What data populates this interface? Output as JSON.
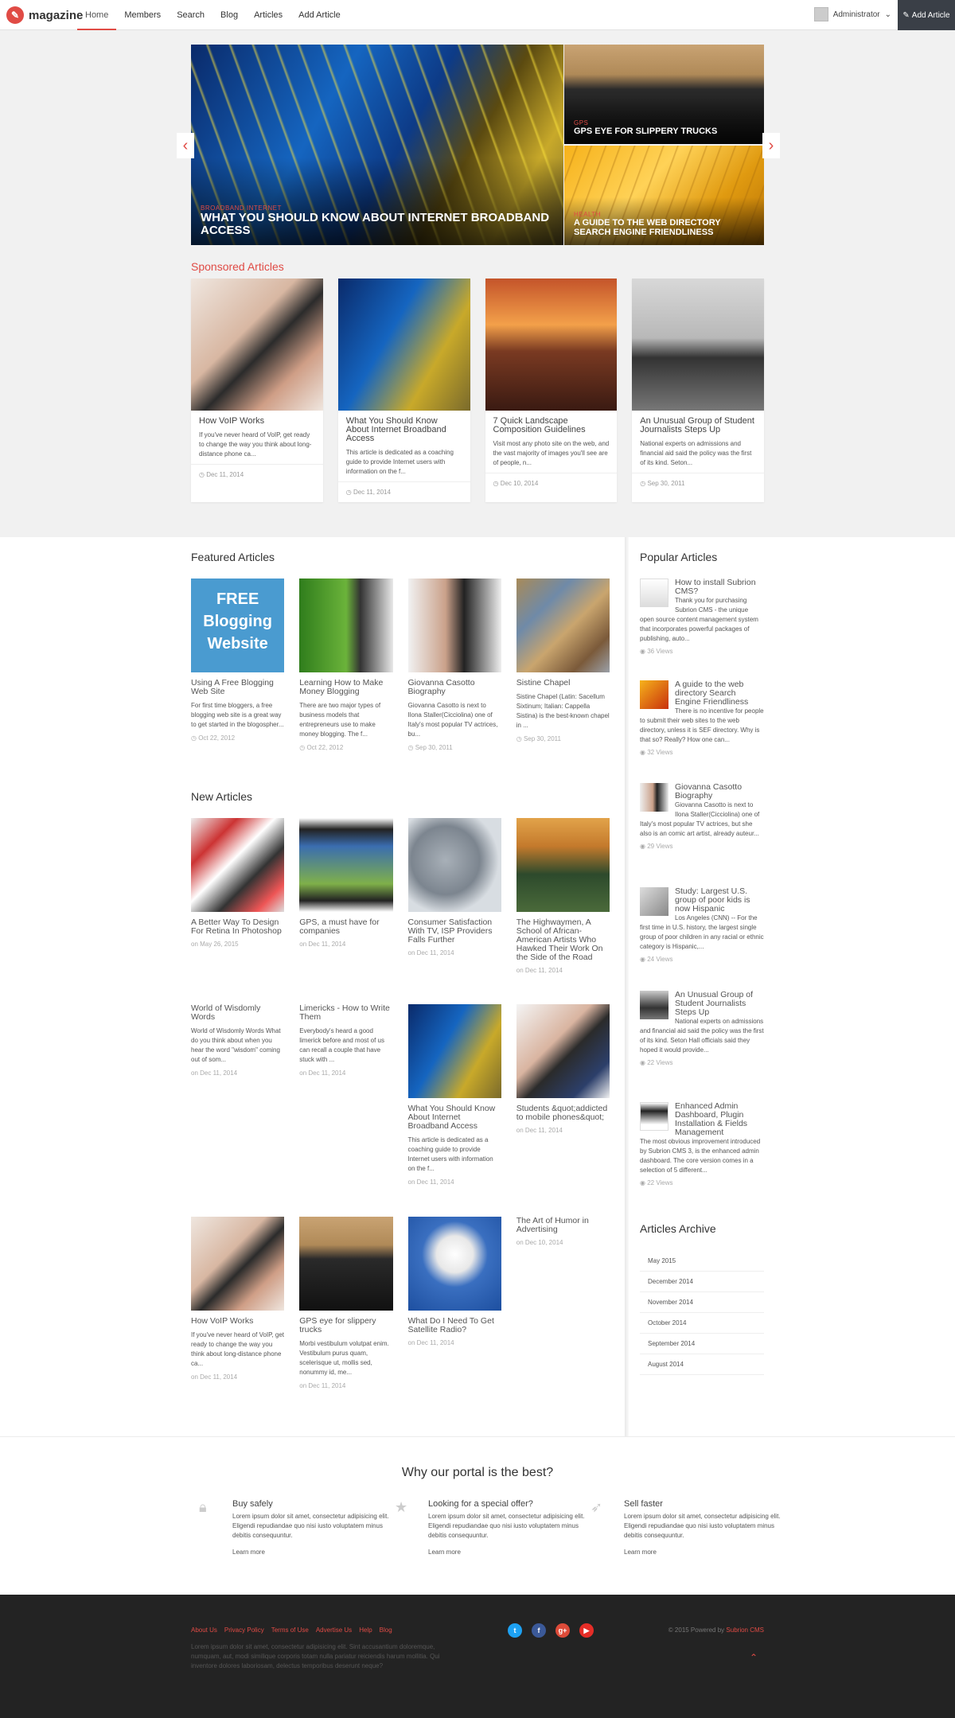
{
  "navbar": {
    "logo": "magazine",
    "items": [
      "Home",
      "Members",
      "Search",
      "Blog",
      "Articles",
      "Add Article"
    ],
    "user": "Administrator",
    "add_button": "Add Article"
  },
  "slider": {
    "main": {
      "category": "Broadband Internet",
      "title": "WHAT YOU SHOULD KNOW ABOUT INTERNET BROADBAND ACCESS"
    },
    "side": [
      {
        "category": "GPS",
        "title": "GPS EYE FOR SLIPPERY TRUCKS"
      },
      {
        "category": "Health",
        "title": "A GUIDE TO THE WEB DIRECTORY SEARCH ENGINE FRIENDLINESS"
      }
    ]
  },
  "sponsored": {
    "title": "Sponsored Articles",
    "items": [
      {
        "title": "How VoIP Works",
        "text": "If you've never heard of VoIP, get ready to change the way you think about long-distance phone ca...",
        "date": "Dec 11, 2014"
      },
      {
        "title": "What You Should Know About Internet Broadband Access",
        "text": "This article is dedicated as a coaching guide to provide Internet users with information on the f...",
        "date": "Dec 11, 2014"
      },
      {
        "title": "7 Quick Landscape Composition Guidelines",
        "text": "Visit most any photo site on the web, and the vast majority of images you'll see are of people, n...",
        "date": "Dec 10, 2014"
      },
      {
        "title": "An Unusual Group of Student Journalists Steps Up",
        "text": "National experts on admissions and financial aid said the policy was the first of its kind. Seton...",
        "date": "Sep 30, 2011"
      }
    ]
  },
  "featured": {
    "title": "Featured Articles",
    "items": [
      {
        "title": "Using A Free Blogging Web Site",
        "text": "For first time bloggers, a free blogging web site is a great way to get started in the blogospher...",
        "date": "Oct 22, 2012",
        "img_text": "FREE Blogging Website"
      },
      {
        "title": "Learning How to Make Money Blogging",
        "text": "There are two major types of business models that entrepreneurs use to make money blogging. The f...",
        "date": "Oct 22, 2012"
      },
      {
        "title": "Giovanna Casotto Biography",
        "text": "Giovanna Casotto is next to Ilona Staller(Cicciolina) one of Italy's most popular TV actrices, bu...",
        "date": "Sep 30, 2011"
      },
      {
        "title": "Sistine Chapel",
        "text": "Sistine Chapel (Latin: Sacellum Sixtinum; Italian: Cappella Sistina) is the best-known chapel in ...",
        "date": "Sep 30, 2011"
      }
    ]
  },
  "new_articles": {
    "title": "New Articles",
    "row1": [
      {
        "title": "A Better Way To Design For Retina In Photoshop",
        "date": "on May 26, 2015"
      },
      {
        "title": "GPS, a must have for companies",
        "date": "on Dec 11, 2014"
      },
      {
        "title": "Consumer Satisfaction With TV, ISP Providers Falls Further",
        "date": "on Dec 11, 2014"
      },
      {
        "title": "The Highwaymen, A School of African-American Artists Who Hawked Their Work On the Side of the Road",
        "date": "on Dec 11, 2014"
      }
    ],
    "row2": [
      {
        "title": "World of Wisdomly Words",
        "text": "World of Wisdomly Words What do you think about when you hear the word \"wisdom\" coming out of som...",
        "date": "on Dec 11, 2014"
      },
      {
        "title": "Limericks - How to Write Them",
        "text": "Everybody's heard a good limerick before and most of us can recall a couple that have stuck with ...",
        "date": "on Dec 11, 2014"
      },
      {
        "title": "What You Should Know About Internet Broadband Access",
        "text": "This article is dedicated as a coaching guide to provide Internet users with information on the f...",
        "date": "on Dec 11, 2014"
      },
      {
        "title": "Students &quot;addicted to mobile phones&quot;",
        "date": "on Dec 11, 2014"
      }
    ],
    "row3": [
      {
        "title": "How VoIP Works",
        "text": "If you've never heard of VoIP, get ready to change the way you think about long-distance phone ca...",
        "date": "on Dec 11, 2014"
      },
      {
        "title": "GPS eye for slippery trucks",
        "text": "Morbi vestibulum volutpat enim. Vestibulum purus quam, scelerisque ut, mollis sed, nonummy id, me...",
        "date": "on Dec 11, 2014"
      },
      {
        "title": "What Do I Need To Get Satellite Radio?",
        "date": "on Dec 11, 2014"
      },
      {
        "title": "The Art of Humor in Advertising",
        "date": "on Dec 10, 2014"
      }
    ]
  },
  "popular": {
    "title": "Popular Articles",
    "items": [
      {
        "title": "How to install Subrion CMS?",
        "text": "Thank you for purchasing Subrion CMS - the unique open source content management system that incorporates powerful packages of publishing, auto...",
        "views": "36 Views"
      },
      {
        "title": "A guide to the web directory Search Engine Friendliness",
        "text": "There is no incentive for people to submit their web sites to the web directory, unless it is SEF directory. Why is that so? Really? How one can...",
        "views": "32 Views"
      },
      {
        "title": "Giovanna Casotto Biography",
        "text": "Giovanna Casotto is next to Ilona Staller(Cicciolina) one of Italy's most popular TV actrices, but she also is an comic art artist, already auteur...",
        "views": "29 Views"
      },
      {
        "title": "Study: Largest U.S. group of poor kids is now Hispanic",
        "text": "Los Angeles (CNN) -- For the first time in U.S. history, the largest single group of poor children in any racial or ethnic category is Hispanic,...",
        "views": "24 Views"
      },
      {
        "title": "An Unusual Group of Student Journalists Steps Up",
        "text": "National experts on admissions and financial aid said the policy was the first of its kind. Seton Hall officials said they hoped it would provide...",
        "views": "22 Views"
      },
      {
        "title": "Enhanced Admin Dashboard, Plugin Installation & Fields Management",
        "text": "The most obvious improvement introduced by Subrion CMS 3, is the enhanced admin dashboard. The core version comes in a selection of 5 different...",
        "views": "22 Views"
      }
    ]
  },
  "archive": {
    "title": "Articles Archive",
    "items": [
      "May 2015",
      "December 2014",
      "November 2014",
      "October 2014",
      "September 2014",
      "August 2014"
    ]
  },
  "why": {
    "title": "Why our portal is the best?",
    "features": [
      {
        "title": "Buy safely",
        "text": "Lorem ipsum dolor sit amet, consectetur adipisicing elit. Eligendi repudiandae quo nisi iusto voluptatem minus debitis consequuntur.",
        "link": "Learn more"
      },
      {
        "title": "Looking for a special offer?",
        "text": "Lorem ipsum dolor sit amet, consectetur adipisicing elit. Eligendi repudiandae quo nisi iusto voluptatem minus debitis consequuntur.",
        "link": "Learn more"
      },
      {
        "title": "Sell faster",
        "text": "Lorem ipsum dolor sit amet, consectetur adipisicing elit. Eligendi repudiandae quo nisi iusto voluptatem minus debitis consequuntur.",
        "link": "Learn more"
      }
    ]
  },
  "footer": {
    "links": [
      "About Us",
      "Privacy Policy",
      "Terms of Use",
      "Advertise Us",
      "Help",
      "Blog"
    ],
    "about": "Lorem ipsum dolor sit amet, consectetur adipisicing elit. Sint accusantium doloremque, numquam, aut, modi similique corporis totam nulla pariatur reiciendis harum mollitia. Qui inventore dolores laboriosam, delectus temporibus deserunt neque?",
    "copyright": "© 2015 Powered by",
    "brand": "Subrion CMS",
    "social": [
      {
        "icon": "twitter",
        "color": "#1da1f2"
      },
      {
        "icon": "facebook",
        "color": "#3b5998"
      },
      {
        "icon": "google-plus",
        "color": "#dd4b39"
      },
      {
        "icon": "youtube",
        "color": "#e52d27"
      }
    ]
  },
  "colors": {
    "accent": "#e04b45",
    "dark": "#232323",
    "band": "#f1f1f1"
  }
}
